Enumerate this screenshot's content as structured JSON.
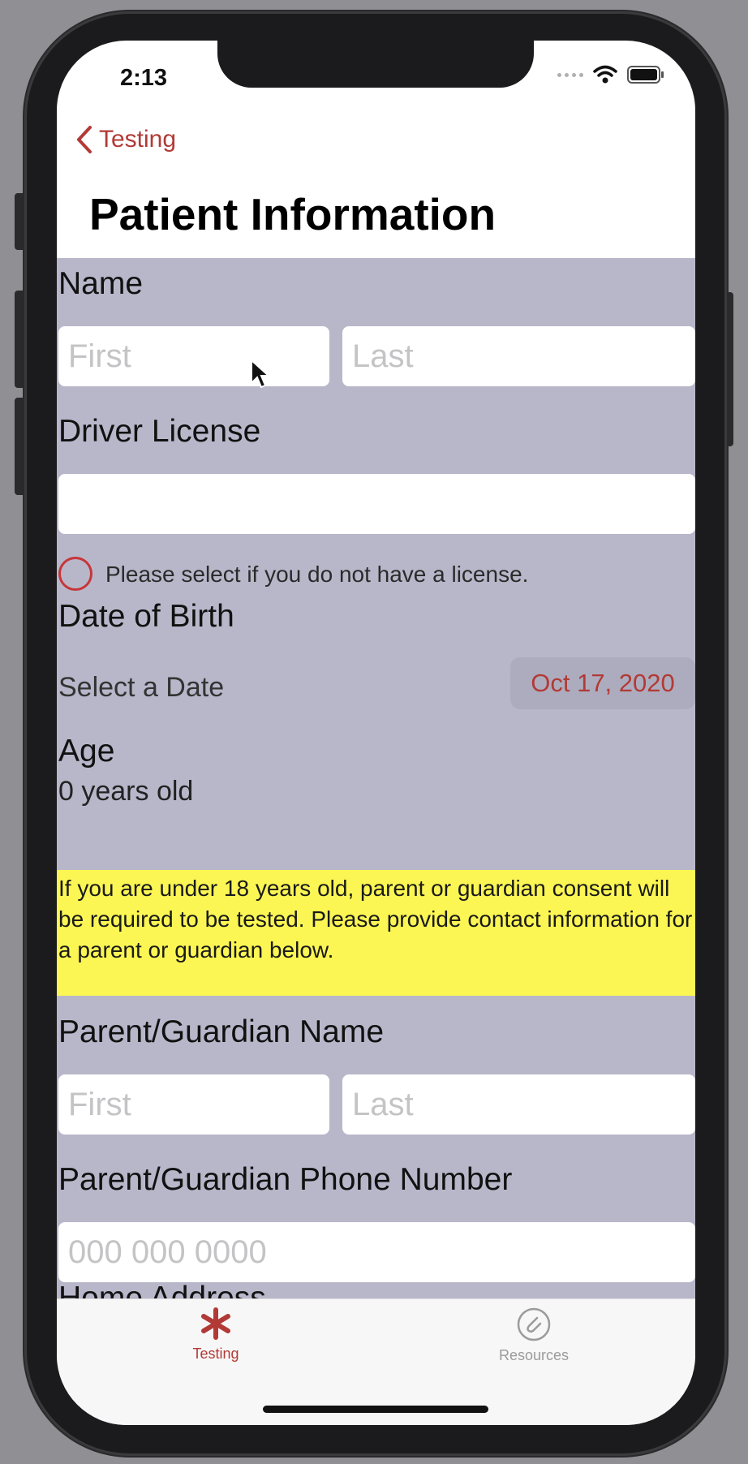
{
  "status_bar": {
    "time": "2:13"
  },
  "nav": {
    "back_label": "Testing",
    "title": "Patient Information"
  },
  "form": {
    "name": {
      "label": "Name",
      "first_placeholder": "First",
      "last_placeholder": "Last",
      "first_value": "",
      "last_value": ""
    },
    "driver_license": {
      "label": "Driver License",
      "value": "",
      "no_license_text": "Please select if you do not have a license."
    },
    "dob": {
      "label": "Date of Birth",
      "select_label": "Select a Date",
      "value": "Oct 17, 2020"
    },
    "age": {
      "label": "Age",
      "value": "0 years old"
    },
    "notice": "If you are under 18 years old, parent or guardian consent will be required to be tested. Please provide contact information for a parent or guardian below.",
    "guardian_name": {
      "label": "Parent/Guardian Name",
      "first_placeholder": "First",
      "last_placeholder": "Last"
    },
    "guardian_phone": {
      "label": "Parent/Guardian Phone Number",
      "placeholder": "000 000 0000"
    },
    "home_address": {
      "label": "Home Address"
    }
  },
  "tabs": [
    {
      "label": "Testing",
      "icon": "asterisk-icon",
      "active": true
    },
    {
      "label": "Resources",
      "icon": "paperclip-icon",
      "active": false
    }
  ],
  "colors": {
    "accent": "#b23a36",
    "form_bg": "#b8b7ca",
    "notice_bg": "#fbf653"
  }
}
